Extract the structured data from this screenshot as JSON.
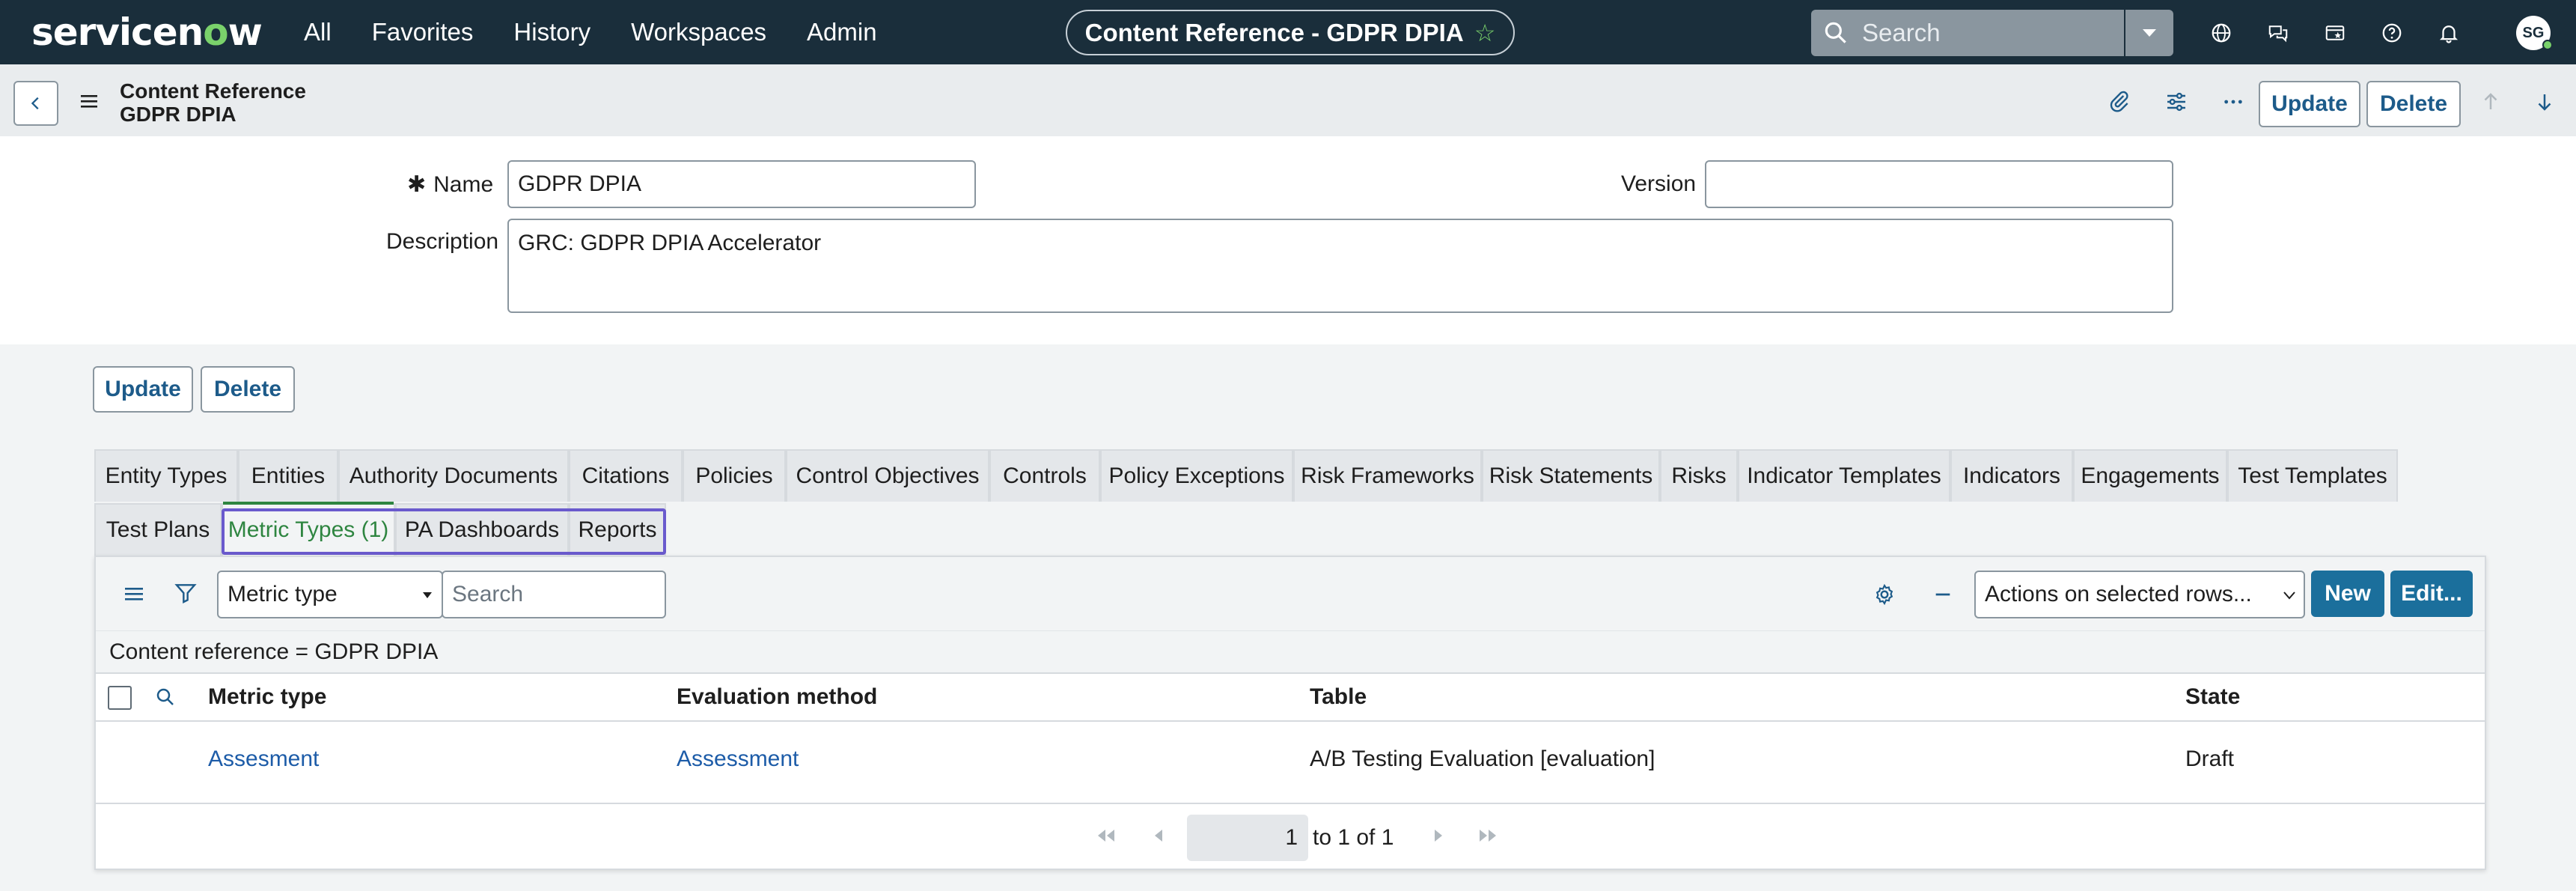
{
  "nav": {
    "logo_pre": "servicen",
    "logo_o": "o",
    "logo_post": "w",
    "links": [
      "All",
      "Favorites",
      "History",
      "Workspaces",
      "Admin"
    ],
    "title": "Content Reference - GDPR DPIA",
    "search_placeholder": "Search",
    "avatar": "SG"
  },
  "header": {
    "title_line1": "Content Reference",
    "title_line2": "GDPR DPIA",
    "update_label": "Update",
    "delete_label": "Delete"
  },
  "form": {
    "name_label": "Name",
    "name_value": "GDPR DPIA",
    "version_label": "Version",
    "version_value": "",
    "description_label": "Description",
    "description_value": "GRC: GDPR DPIA Accelerator",
    "update_label": "Update",
    "delete_label": "Delete"
  },
  "tabs_row1": [
    "Entity Types",
    "Entities",
    "Authority Documents",
    "Citations",
    "Policies",
    "Control Objectives",
    "Controls",
    "Policy Exceptions",
    "Risk Frameworks",
    "Risk Statements",
    "Risks",
    "Indicator Templates",
    "Indicators",
    "Engagements",
    "Test Templates"
  ],
  "tabs_row2": [
    "Test Plans",
    "Metric Types (1)",
    "PA Dashboards",
    "Reports"
  ],
  "active_tab": "Metric Types (1)",
  "list": {
    "field_select": "Metric type",
    "search_placeholder": "Search",
    "actions_select": "Actions on selected rows...",
    "new_label": "New",
    "edit_label": "Edit...",
    "breadcrumb": "Content reference = GDPR DPIA",
    "columns": [
      "Metric type",
      "Evaluation method",
      "Table",
      "State"
    ],
    "rows": [
      [
        "Assesment",
        "Assessment",
        "A/B Testing Evaluation [evaluation]",
        "Draft"
      ]
    ],
    "pager_page": "1",
    "pager_text": "to 1 of 1"
  },
  "colors": {
    "nav_bg": "#1a2e3b",
    "accent_green": "#7ad26b",
    "primary_button": "#1b6f9c",
    "link": "#1d5ca8",
    "highlight": "#6a5acd"
  }
}
